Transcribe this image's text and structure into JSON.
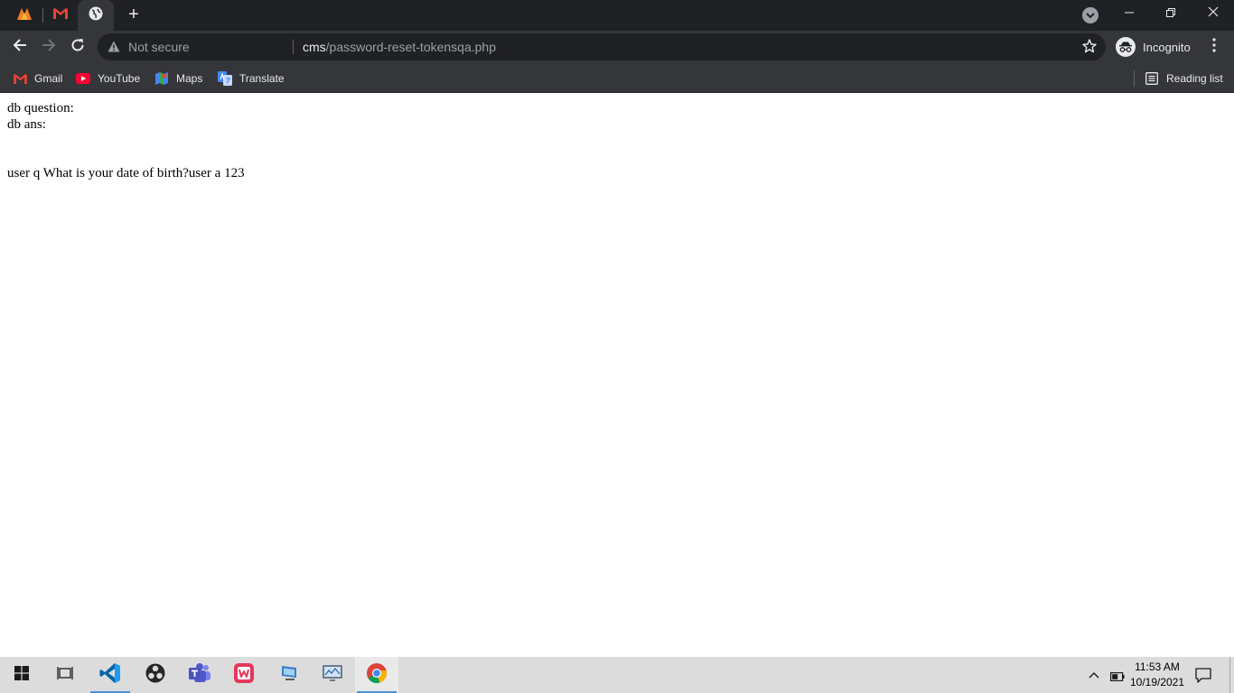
{
  "browser": {
    "address": {
      "security_label": "Not secure",
      "url_host": "cms",
      "url_path": "/password-reset-tokensqa.php"
    },
    "profile_label": "Incognito",
    "bookmarks": [
      {
        "label": "Gmail",
        "icon": "gmail-icon"
      },
      {
        "label": "YouTube",
        "icon": "youtube-icon"
      },
      {
        "label": "Maps",
        "icon": "maps-icon"
      },
      {
        "label": "Translate",
        "icon": "translate-icon"
      }
    ],
    "reading_list_label": "Reading list"
  },
  "page": {
    "line1": "db question:",
    "line2": "db ans:",
    "line3": "user q What is your date of birth?user a 123"
  },
  "taskbar": {
    "time": "11:53 AM",
    "date": "10/19/2021"
  },
  "colors": {
    "chrome_dark": "#202124",
    "chrome_toolbar": "#35363a",
    "taskbar": "#dcdcdc",
    "accent": "#4a8fd8"
  }
}
